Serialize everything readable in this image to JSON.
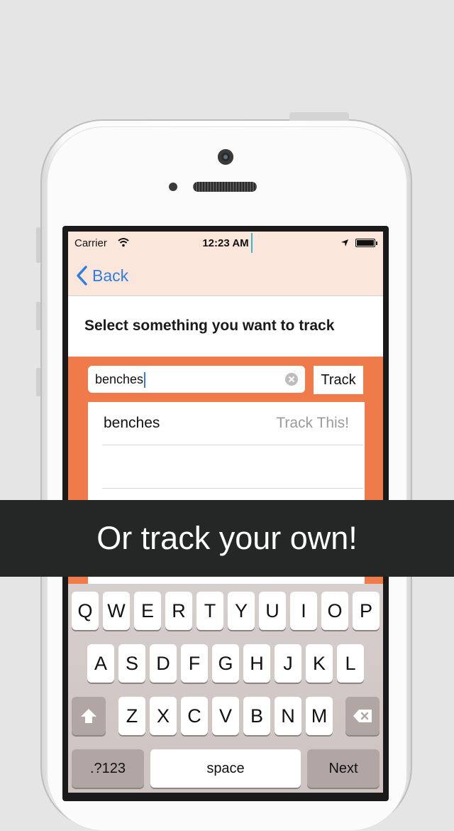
{
  "status": {
    "carrier": "Carrier",
    "time": "12:23 AM"
  },
  "nav": {
    "back_label": "Back"
  },
  "page": {
    "title": "Select something you want to track"
  },
  "search": {
    "value": "benches",
    "track_label": "Track"
  },
  "results": [
    {
      "name": "benches",
      "action": "Track This!"
    },
    {
      "name": "",
      "action": ""
    }
  ],
  "keyboard": {
    "row1": [
      "Q",
      "W",
      "E",
      "R",
      "T",
      "Y",
      "U",
      "I",
      "O",
      "P"
    ],
    "row2": [
      "A",
      "S",
      "D",
      "F",
      "G",
      "H",
      "J",
      "K",
      "L"
    ],
    "row3": [
      "Z",
      "X",
      "C",
      "V",
      "B",
      "N",
      "M"
    ],
    "numbers_label": ".?123",
    "space_label": "space",
    "next_label": "Next"
  },
  "banner": {
    "text": "Or track your own!"
  },
  "colors": {
    "accent": "#f07b4a",
    "link": "#2f7ee0",
    "banner": "#252726",
    "navbar": "#fbe6db"
  }
}
